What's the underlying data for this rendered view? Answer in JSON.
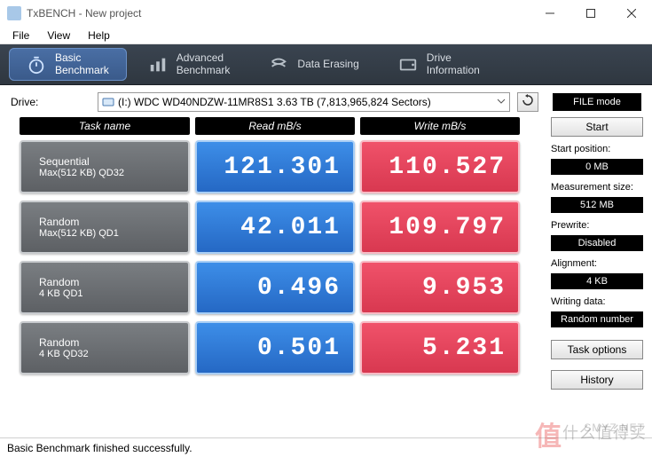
{
  "window": {
    "title": "TxBENCH - New project"
  },
  "menu": {
    "file": "File",
    "view": "View",
    "help": "Help"
  },
  "tabs": {
    "basic": "Basic\nBenchmark",
    "advanced": "Advanced\nBenchmark",
    "erasing": "Data Erasing",
    "drive": "Drive\nInformation"
  },
  "drive": {
    "label": "Drive:",
    "value": "(I:) WDC WD40NDZW-11MR8S1  3.63 TB (7,813,965,824 Sectors)",
    "mode": "FILE mode"
  },
  "headers": {
    "task": "Task name",
    "read": "Read mB/s",
    "write": "Write mB/s"
  },
  "tasks": [
    {
      "name1": "Sequential",
      "name2": "Max(512 KB) QD32",
      "read": "121.301",
      "write": "110.527"
    },
    {
      "name1": "Random",
      "name2": "Max(512 KB) QD1",
      "read": "42.011",
      "write": "109.797"
    },
    {
      "name1": "Random",
      "name2": "4 KB QD1",
      "read": "0.496",
      "write": "9.953"
    },
    {
      "name1": "Random",
      "name2": "4 KB QD32",
      "read": "0.501",
      "write": "5.231"
    }
  ],
  "side": {
    "start": "Start",
    "startpos_label": "Start position:",
    "startpos": "0 MB",
    "meassize_label": "Measurement size:",
    "meassize": "512 MB",
    "prewrite_label": "Prewrite:",
    "prewrite": "Disabled",
    "align_label": "Alignment:",
    "align": "4 KB",
    "wdata_label": "Writing data:",
    "wdata": "Random number",
    "taskopt": "Task options",
    "history": "History"
  },
  "status": "Basic Benchmark finished successfully.",
  "watermark": {
    "line1": "SMYZ.NET",
    "line2_a": "值",
    "line2_b": "什么值得买"
  }
}
